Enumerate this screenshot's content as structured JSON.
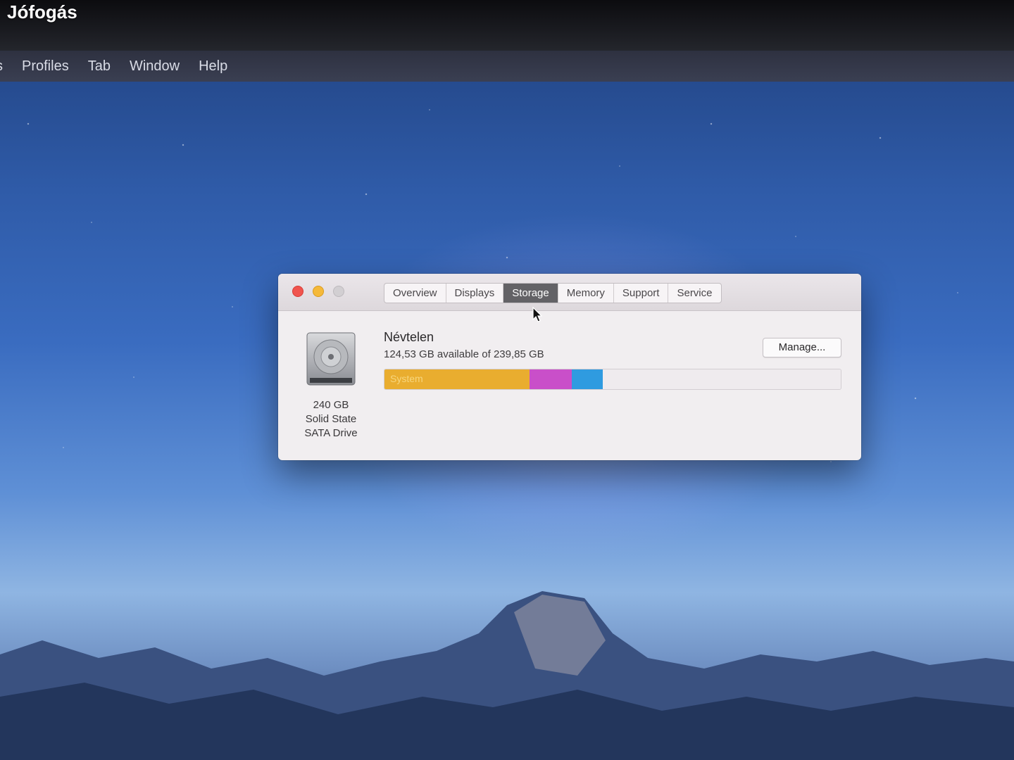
{
  "watermark": "Jófogás",
  "menubar": {
    "items": [
      "s",
      "Profiles",
      "Tab",
      "Window",
      "Help"
    ]
  },
  "window": {
    "tabs": [
      {
        "label": "Overview",
        "active": false
      },
      {
        "label": "Displays",
        "active": false
      },
      {
        "label": "Storage",
        "active": true
      },
      {
        "label": "Memory",
        "active": false
      },
      {
        "label": "Support",
        "active": false
      },
      {
        "label": "Service",
        "active": false
      }
    ],
    "drive": {
      "icon": "hard-drive-icon",
      "capacity": "240 GB",
      "type_line1": "Solid State",
      "type_line2": "SATA Drive"
    },
    "volume": {
      "name": "Névtelen",
      "available_text": "124,53 GB available of 239,85 GB",
      "manage_label": "Manage..."
    },
    "storage_bar": {
      "total_gb": 239.85,
      "segments": [
        {
          "label": "System",
          "fraction": 0.318,
          "color": "#e9ad2f"
        },
        {
          "label": "",
          "fraction": 0.093,
          "color": "#c94fc9"
        },
        {
          "label": "",
          "fraction": 0.068,
          "color": "#2f9be0"
        }
      ],
      "free_fraction": 0.521,
      "free_color": "#efebee"
    }
  },
  "colors": {
    "close": "#f0544e",
    "minimize": "#f5b93a",
    "zoom": "#d2cfd2",
    "active_tab": "#636266"
  }
}
